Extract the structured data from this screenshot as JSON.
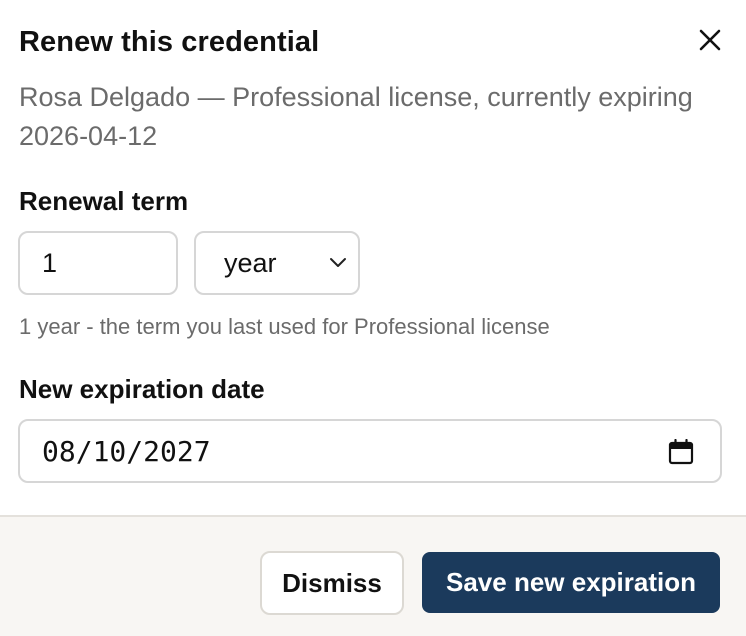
{
  "dialog": {
    "title": "Renew this credential",
    "subtitle": "Rosa Delgado — Professional license, currently expiring 2026-04-12"
  },
  "renewal": {
    "label": "Renewal term",
    "quantity": "1",
    "unit": "year",
    "hint": "1 year - the term you last used for Professional license"
  },
  "expiration": {
    "label": "New expiration date",
    "value": "08/10/2027"
  },
  "actions": {
    "dismiss_label": "Dismiss",
    "save_label": "Save new expiration"
  },
  "colors": {
    "primary": "#1b3a5c",
    "muted_text": "#6b6b6b",
    "footer_bg": "#f8f6f3"
  },
  "icons": {
    "close": "close-icon",
    "dropdown": "chevron-down-icon",
    "calendar": "calendar-icon"
  }
}
